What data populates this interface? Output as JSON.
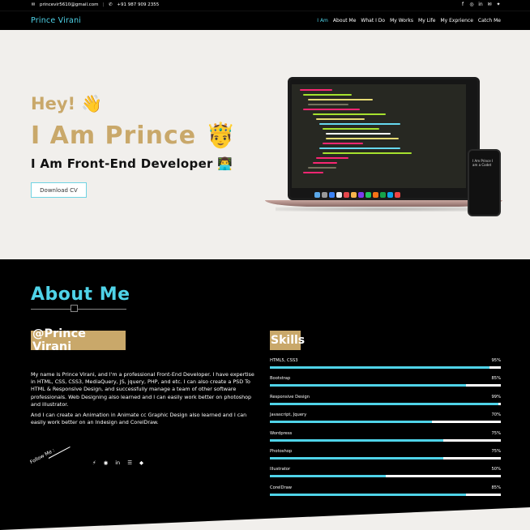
{
  "topbar": {
    "email": "princevir5610@gmail.com",
    "phone": "+91 987 909 2355",
    "social_icons": [
      "facebook-icon",
      "instagram-icon",
      "linkedin-icon",
      "mail-icon",
      "twitter-icon"
    ]
  },
  "nav": {
    "brand": "Prince Virani",
    "items": [
      "I Am",
      "About Me",
      "What I Do",
      "My Works",
      "My Life",
      "My Exprience",
      "Catch Me"
    ],
    "active": "I Am"
  },
  "hero": {
    "greeting": "Hey! 👋",
    "headline": "I Am Prince 🤴",
    "role": "I Am Front-End Developer 👨‍💻",
    "cta": "Download CV",
    "phone_text": "I Am Prince I am a Codet"
  },
  "about": {
    "title": "About Me",
    "name_badge": "@Prince Virani",
    "bio_1": "My name is Prince Virani, and I'm a professional Front-End Developer. I have expertise in HTML, CSS, CSS3, MediaQuery, JS, jquery, PHP, and etc. I can also create a PSD To HTML & Responsive Design, and successfully manage a team of other software professionals. Web Designing also learned and I can easily work better on photoshop and illustrator.",
    "bio_2": "And I can create an Animation in Animate cc Graphic Design also learned and I can easily work better on an Indesign and CorelDraw.",
    "follow_label": "Follow Me :",
    "social_icons": [
      "dribbble-icon",
      "skype-icon",
      "linkedin-icon",
      "stackoverflow-icon",
      "bitbucket-icon"
    ]
  },
  "skills": {
    "title": "Skills",
    "items": [
      {
        "label": "HTML5, CSS3",
        "value": 95
      },
      {
        "label": "Bootstrap",
        "value": 85
      },
      {
        "label": "Responsive Design",
        "value": 99
      },
      {
        "label": "Javascript, Jquery",
        "value": 70
      },
      {
        "label": "Wordpress",
        "value": 75
      },
      {
        "label": "Photoshop",
        "value": 75
      },
      {
        "label": "Illustrator",
        "value": 50
      },
      {
        "label": "CorelDraw",
        "value": 85
      }
    ]
  },
  "colors": {
    "accent": "#4fd3e8",
    "gold": "#c9a86a",
    "hero_bg": "#f1efec"
  }
}
